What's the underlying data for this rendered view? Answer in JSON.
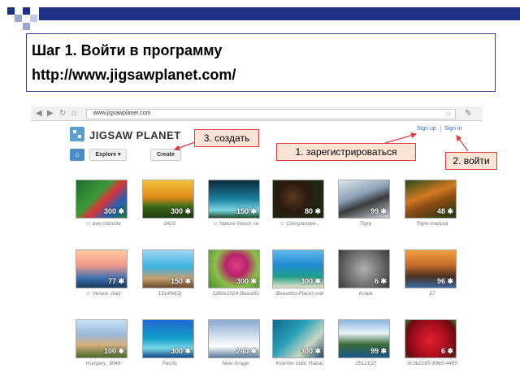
{
  "slide": {
    "title_line1": "Шаг 1. Войти в программу",
    "title_line2": "http://www.jigsawplanet.com/"
  },
  "browser": {
    "url": "www.jigsawplanet.com",
    "nav_icons": [
      "back-icon",
      "forward-icon",
      "reload-icon",
      "home-icon"
    ]
  },
  "site": {
    "logo_text": "JIGSAW PLANET",
    "sign_up": "Sign up",
    "separator": "|",
    "sign_in": "Sign in",
    "explore_label": "Explore ▾",
    "create_label": "Create"
  },
  "callouts": {
    "create": "3. создать",
    "register": "1. зарегистрироваться",
    "login": "2. войти"
  },
  "puzzles": [
    {
      "badge": "300 ✱",
      "caption": "ave colorida",
      "user_icon": true
    },
    {
      "badge": "300 ✱",
      "caption": "3425",
      "user_icon": false
    },
    {
      "badge": "150 ✱",
      "caption": "Nature freash se",
      "user_icon": true
    },
    {
      "badge": "80 ✱",
      "caption": "Chimpanzee...",
      "user_icon": true
    },
    {
      "badge": "99 ✱",
      "caption": "Tigre",
      "user_icon": false
    },
    {
      "badge": "48 ✱",
      "caption": "Tigre-malasia",
      "user_icon": false
    },
    {
      "badge": "77 ✱",
      "caption": "Venice, Italy",
      "user_icon": true
    },
    {
      "badge": "150 ✱",
      "caption": "131494[1]",
      "user_icon": false
    },
    {
      "badge": "300 ✱",
      "caption": "1280x1024 Beautifu",
      "user_icon": false
    },
    {
      "badge": "300 ✱",
      "caption": "Beautiful-Places-nat",
      "user_icon": false
    },
    {
      "badge": "6 ✱",
      "caption": "Koala",
      "user_icon": false
    },
    {
      "badge": "96 ✱",
      "caption": "27",
      "user_icon": false
    },
    {
      "badge": "100 ✱",
      "caption": "Hungary_3048",
      "user_icon": false
    },
    {
      "badge": "300 ✱",
      "caption": "Pacific",
      "user_icon": false
    },
    {
      "badge": "240 ✱",
      "caption": "New Image",
      "user_icon": false
    },
    {
      "badge": "300 ✱",
      "caption": "Kvarner óbbl, Rabac",
      "user_icon": false
    },
    {
      "badge": "99 ✱",
      "caption": "25121[2]",
      "user_icon": false
    },
    {
      "badge": "6 ✱",
      "caption": "9c3b2185-8965-4485",
      "user_icon": false
    }
  ],
  "colors": {
    "header_bar": "#1f2f86",
    "callout_border": "#e0393e",
    "callout_fill": "#fbe4d5",
    "link": "#3b6fb6"
  }
}
